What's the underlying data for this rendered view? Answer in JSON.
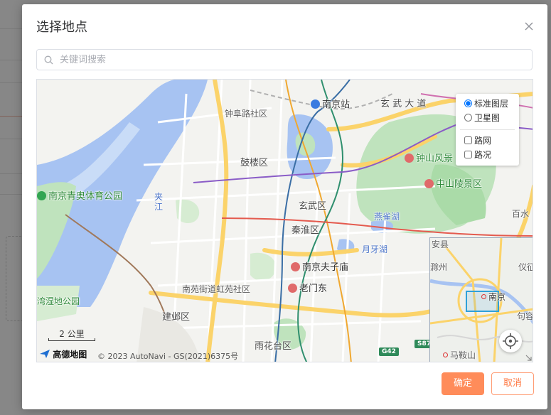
{
  "dialog": {
    "title": "选择地点"
  },
  "search": {
    "placeholder": "关键词搜索",
    "value": ""
  },
  "map": {
    "layers": {
      "options": [
        {
          "label": "标准图层",
          "type": "radio",
          "checked": true
        },
        {
          "label": "卫星图",
          "type": "radio",
          "checked": false
        },
        {
          "label": "路网",
          "type": "checkbox",
          "checked": false
        },
        {
          "label": "路况",
          "type": "checkbox",
          "checked": false
        }
      ]
    },
    "labels": {
      "nanjing_station": "南京站",
      "zhongfulu": "钟阜路社区",
      "xuanwu_avenue": "玄 武 大 道",
      "gulou": "鼓楼区",
      "zhongshan_scenic": "钟山风景",
      "sun_yatsen": "中山陵景区",
      "olympic_park": "南京青奥体育公园",
      "jiajiang": "夹 江",
      "xuanwu_district": "玄武区",
      "yanque_lake": "燕雀湖",
      "qinhuai": "秦淮区",
      "yueya_lake": "月牙湖",
      "fuzimiao": "南京夫子庙",
      "laomendong": "老门东",
      "nanyuan": "南苑街道虹苑社区",
      "wetland": "湾湿地公园",
      "jianye": "建邺区",
      "yuhuatai": "雨花台区",
      "baishui": "百水",
      "g42": "G42",
      "s87": "S87"
    },
    "minimap": {
      "labels": {
        "anqing": "安县",
        "chuzhou": "滁州",
        "yizheng": "仪征",
        "nanjing": "南京",
        "jurong": "句容",
        "maanshan": "马鞍山"
      }
    },
    "scale": "2 公里",
    "logo": "高德地图",
    "copyright": "© 2023 AutoNavi - GS(2021)6375号"
  },
  "buttons": {
    "confirm": "确定",
    "cancel": "取消"
  },
  "colors": {
    "accent": "#ff8c5a",
    "water": "#a7c3f2",
    "park": "#bfe3bd",
    "road_major": "#fbd36a"
  }
}
